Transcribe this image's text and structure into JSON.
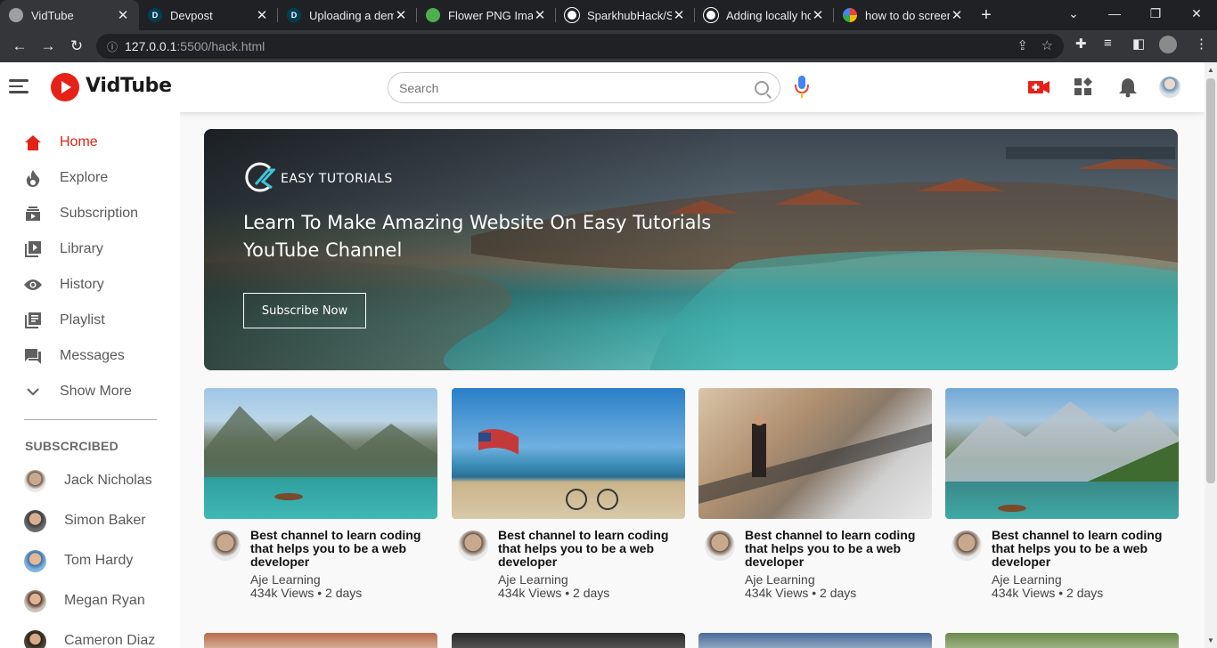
{
  "browser": {
    "tabs": [
      {
        "title": "VidTube",
        "icon": "globe-icon",
        "color": "#9aa0a6"
      },
      {
        "title": "Devpost",
        "icon": "devpost-icon",
        "color": "#003e54"
      },
      {
        "title": "Uploading a dem",
        "icon": "devpost-icon",
        "color": "#003e54"
      },
      {
        "title": "Flower PNG Imag",
        "icon": "leaf-icon",
        "color": "#4caf50"
      },
      {
        "title": "SparkhubHack/Sp",
        "icon": "github-icon",
        "color": "#ffffff"
      },
      {
        "title": "Adding locally ho",
        "icon": "github-icon",
        "color": "#ffffff"
      },
      {
        "title": "how to do screen",
        "icon": "google-icon",
        "color": "#ffffff"
      }
    ],
    "new_tab": "+",
    "url_host": "127.0.0.1",
    "url_rest": ":5500/hack.html"
  },
  "header": {
    "logo": "VidTube",
    "search_placeholder": "Search"
  },
  "sidebar": {
    "items": [
      {
        "label": "Home",
        "icon": "home-icon",
        "active": true
      },
      {
        "label": "Explore",
        "icon": "explore-icon"
      },
      {
        "label": "Subscription",
        "icon": "subscription-icon"
      },
      {
        "label": "Library",
        "icon": "library-icon"
      },
      {
        "label": "History",
        "icon": "history-icon"
      },
      {
        "label": "Playlist",
        "icon": "playlist-icon"
      },
      {
        "label": "Messages",
        "icon": "messages-icon"
      },
      {
        "label": "Show More",
        "icon": "chevron-down-icon"
      }
    ],
    "subscribed_heading": "SUBSCRCIBED",
    "subscribed": [
      {
        "name": "Jack Nicholas"
      },
      {
        "name": "Simon Baker"
      },
      {
        "name": "Tom Hardy"
      },
      {
        "name": "Megan Ryan"
      },
      {
        "name": "Cameron Diaz"
      }
    ]
  },
  "banner": {
    "brand": "EASY TUTORIALS",
    "headline": "Learn To Make Amazing Website On Easy Tutorials YouTube Channel",
    "button": "Subscribe Now"
  },
  "videos": [
    {
      "title": "Best channel to learn coding that helps you to be a web developer",
      "channel": "Aje Learning",
      "stats": "434k Views • 2 days"
    },
    {
      "title": "Best channel to learn coding that helps you to be a web developer",
      "channel": "Aje Learning",
      "stats": "434k Views • 2 days"
    },
    {
      "title": "Best channel to learn coding that helps you to be a web developer",
      "channel": "Aje Learning",
      "stats": "434k Views • 2 days"
    },
    {
      "title": "Best channel to learn coding that helps you to be a web developer",
      "channel": "Aje Learning",
      "stats": "434k Views • 2 days"
    }
  ],
  "colors": {
    "brand_red": "#e62117",
    "chrome_dark": "#202124"
  }
}
